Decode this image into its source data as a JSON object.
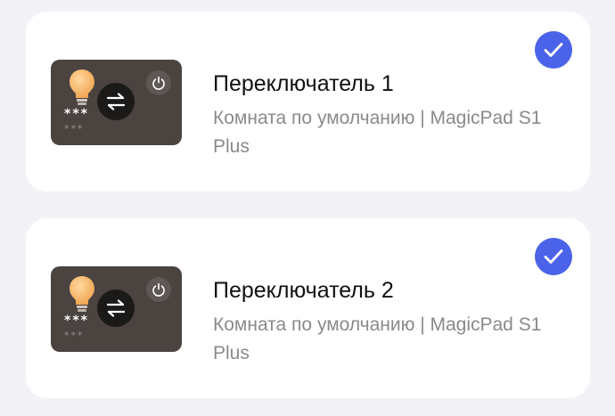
{
  "devices": [
    {
      "name": "Переключатель 1",
      "location": "Комната по умолчанию | MagicPad S1 Plus",
      "thumb_primary": "***",
      "thumb_secondary": "***",
      "selected": true
    },
    {
      "name": "Переключатель 2",
      "location": "Комната по умолчанию | MagicPad S1 Plus",
      "thumb_primary": "***",
      "thumb_secondary": "***",
      "selected": true
    }
  ],
  "colors": {
    "page_background": "#f2f2f7",
    "card_background": "#ffffff",
    "thumbnail_background": "#4a4340",
    "bulb": "#f6b96a",
    "check_accent": "#4a63e8",
    "subtitle_text": "#8a8a8e"
  },
  "icons": {
    "thumbnail_left": "light-bulb-icon",
    "thumbnail_center": "swap-arrows-icon",
    "thumbnail_right": "power-icon",
    "selection": "checkmark-icon"
  }
}
